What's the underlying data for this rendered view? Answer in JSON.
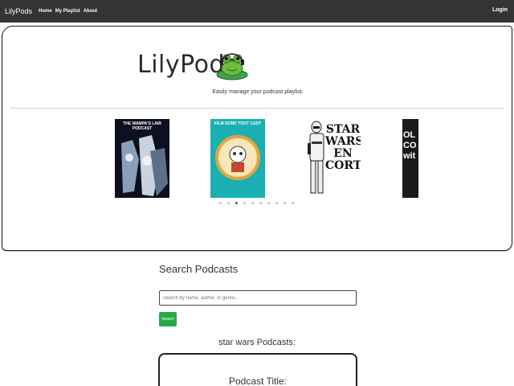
{
  "nav": {
    "brand": "LilyPods",
    "links": [
      "Home",
      "My Playlist",
      "About"
    ],
    "login": "Login"
  },
  "hero": {
    "logo_text": "LilyPods",
    "tagline": "Easily manage your podcast playlist.",
    "covers": [
      {
        "name": "wampa-lair-cover",
        "title": "THE WAMPA'S LAIR PODCAST"
      },
      {
        "name": "film-dork-cover",
        "title": "FILM DORK TOOT CAST"
      },
      {
        "name": "star-wars-en-corto-cover",
        "title": "STAR WARS EN CORTO"
      },
      {
        "name": "partial-cover",
        "title": "OL CO wit"
      }
    ],
    "indicator_count": 10,
    "active_indicator": 2
  },
  "search": {
    "title": "Search Podcasts",
    "placeholder": "Search by name, author, or genre...",
    "button": "Search"
  },
  "results": {
    "title": "star wars Podcasts:",
    "card_title": "Podcast Title:"
  },
  "colors": {
    "navbar": "#343434",
    "search_button": "#28a745",
    "frog": "#6cbf3c"
  }
}
